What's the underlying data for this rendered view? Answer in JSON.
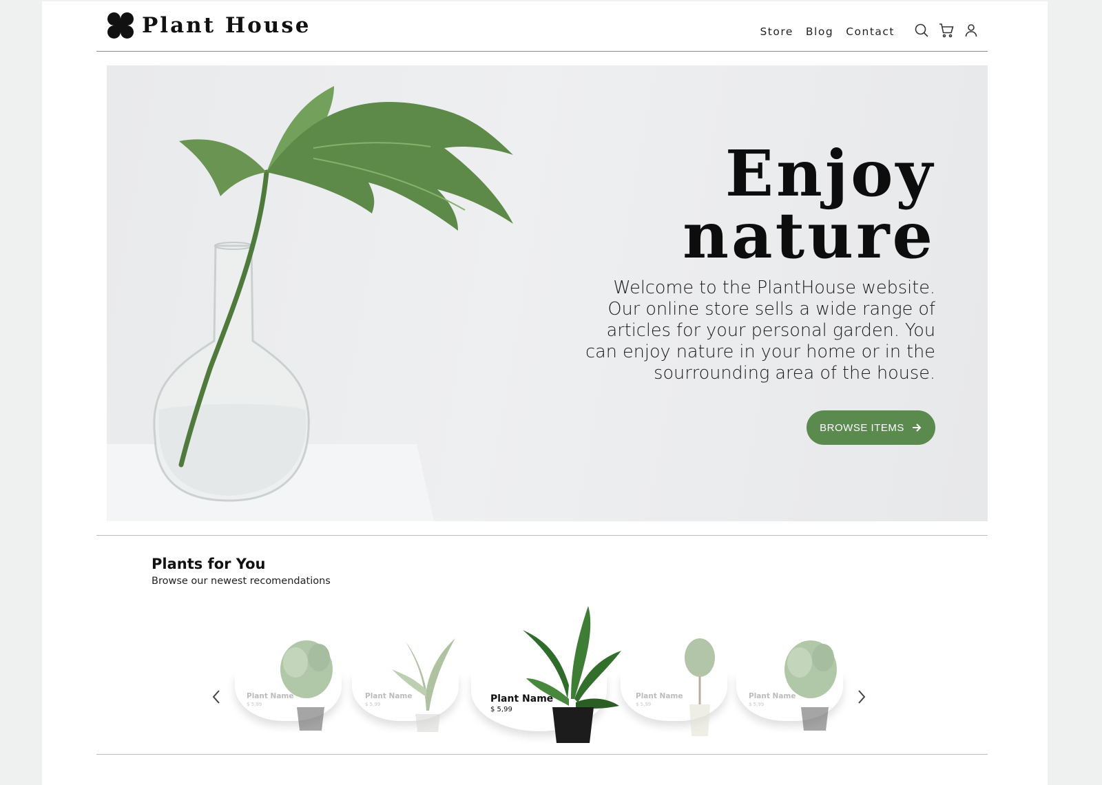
{
  "brand": {
    "name": "Plant House"
  },
  "nav": {
    "items": [
      "Store",
      "Blog",
      "Contact"
    ]
  },
  "header_icons": [
    "search-icon",
    "cart-icon",
    "user-icon"
  ],
  "hero": {
    "title_line1": "Enjoy",
    "title_line2": "nature",
    "text": "Welcome to the PlantHouse website. Our online store sells a wide range of articles for your personal garden. You can enjoy nature in your home or in the sourrounding area of the house.",
    "button_label": "BROWSE ITEMS"
  },
  "plants": {
    "title": "Plants for You",
    "subtitle": "Browse our newest recomendations",
    "items": [
      {
        "name": "Plant Name",
        "price": "$ 5,99"
      },
      {
        "name": "Plant Name",
        "price": "$ 5,99"
      },
      {
        "name": "Plant Name",
        "price": "$ 5,99"
      },
      {
        "name": "Plant Name",
        "price": "$ 5,99"
      },
      {
        "name": "Plant Name",
        "price": "$ 5,99"
      }
    ]
  },
  "colors": {
    "accent": "#5a8a4e",
    "background": "#eff1f0",
    "hero_bg": "#ebeced"
  }
}
